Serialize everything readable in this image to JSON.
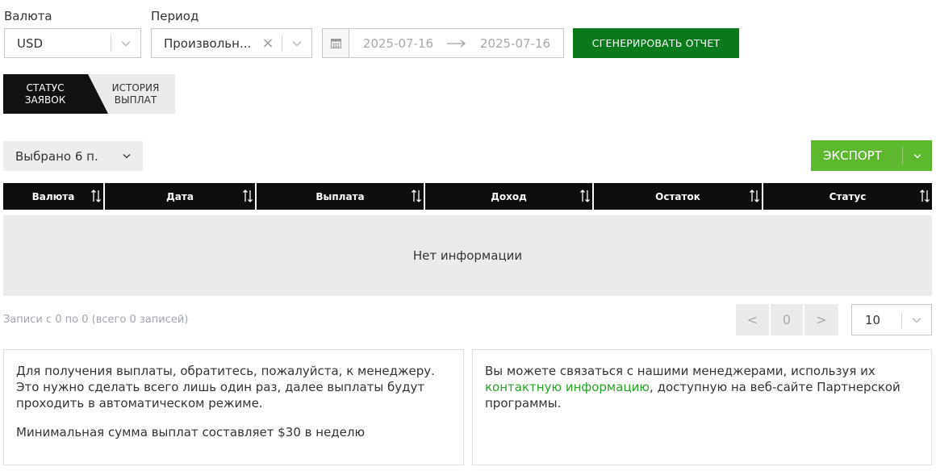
{
  "filters": {
    "currency_label": "Валюта",
    "currency_value": "USD",
    "period_label": "Период",
    "period_value": "Произвольн...",
    "date_from": "2025-07-16",
    "date_to": "2025-07-16",
    "generate_label": "СГЕНЕРИРОВАТЬ ОТЧЕТ"
  },
  "tabs": [
    {
      "line1": "СТАТУС",
      "line2": "ЗАЯВОК",
      "active": true
    },
    {
      "line1": "ИСТОРИЯ",
      "line2": "ВЫПЛАТ",
      "active": false
    }
  ],
  "toolbar": {
    "columns_selected": "Выбрано 6 п.",
    "export_label": "ЭКСПОРТ"
  },
  "table": {
    "columns": [
      "Валюта",
      "Дата",
      "Выплата",
      "Доход",
      "Остаток",
      "Статус"
    ],
    "empty_text": "Нет информации"
  },
  "pagination": {
    "records_text": "Записи с 0 по 0 (всего 0 записей)",
    "prev": "<",
    "page": "0",
    "next": ">",
    "page_size": "10"
  },
  "info": {
    "left_p1": "Для получения выплаты, обратитесь, пожалуйста, к менеджеру. Это нужно сделать всего лишь один раз, далее выплаты будут проходить в автоматическом режиме.",
    "left_p2": "Минимальная сумма выплат составляет $30 в неделю",
    "right_before": "Вы можете связаться с нашими менеджерами, используя их ",
    "right_link": "контактную информацию",
    "right_after": ", доступную на веб-сайте Партнерской программы."
  },
  "colors": {
    "generate_button": "#0a7a1b",
    "export_button": "#5cb82e",
    "table_header": "#0e0e0e",
    "link": "#2aa12a"
  }
}
